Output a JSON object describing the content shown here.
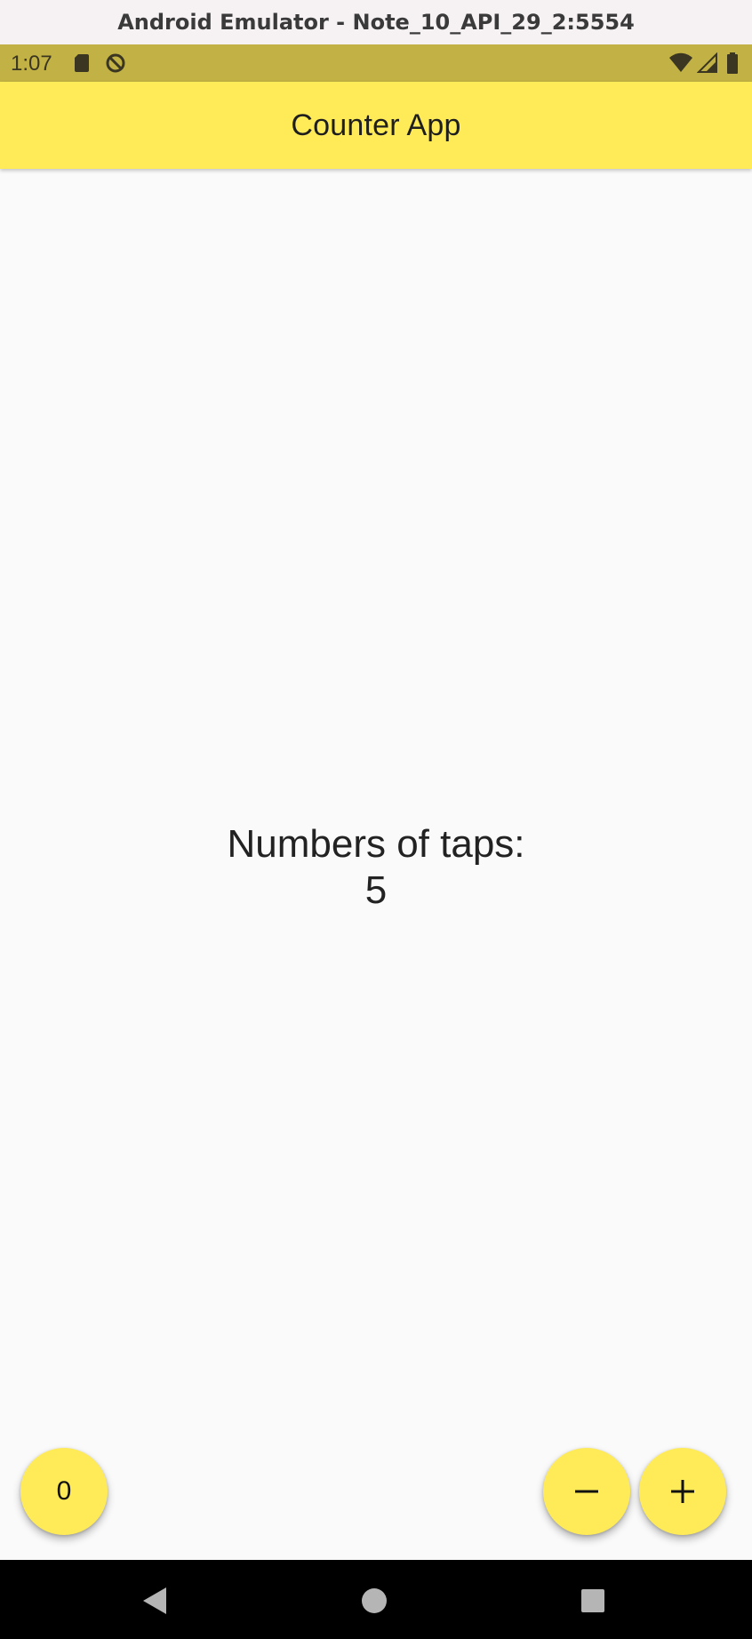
{
  "window": {
    "title": "Android Emulator - Note_10_API_29_2:5554"
  },
  "status_bar": {
    "time": "1:07",
    "left_icons": [
      "sd-card-icon",
      "no-sync-icon"
    ],
    "right_icons": [
      "wifi-icon",
      "cell-signal-icon",
      "battery-icon"
    ],
    "background": "#c2b245"
  },
  "app_bar": {
    "title": "Counter App",
    "background": "#ffeb57"
  },
  "counter": {
    "label": "Numbers of taps:",
    "value": "5"
  },
  "fabs": {
    "reset_label": "0",
    "decrement_icon": "minus-icon",
    "increment_icon": "plus-icon",
    "color": "#ffeb57"
  },
  "nav_bar": {
    "buttons": [
      "back-icon",
      "home-icon",
      "recents-icon"
    ]
  }
}
